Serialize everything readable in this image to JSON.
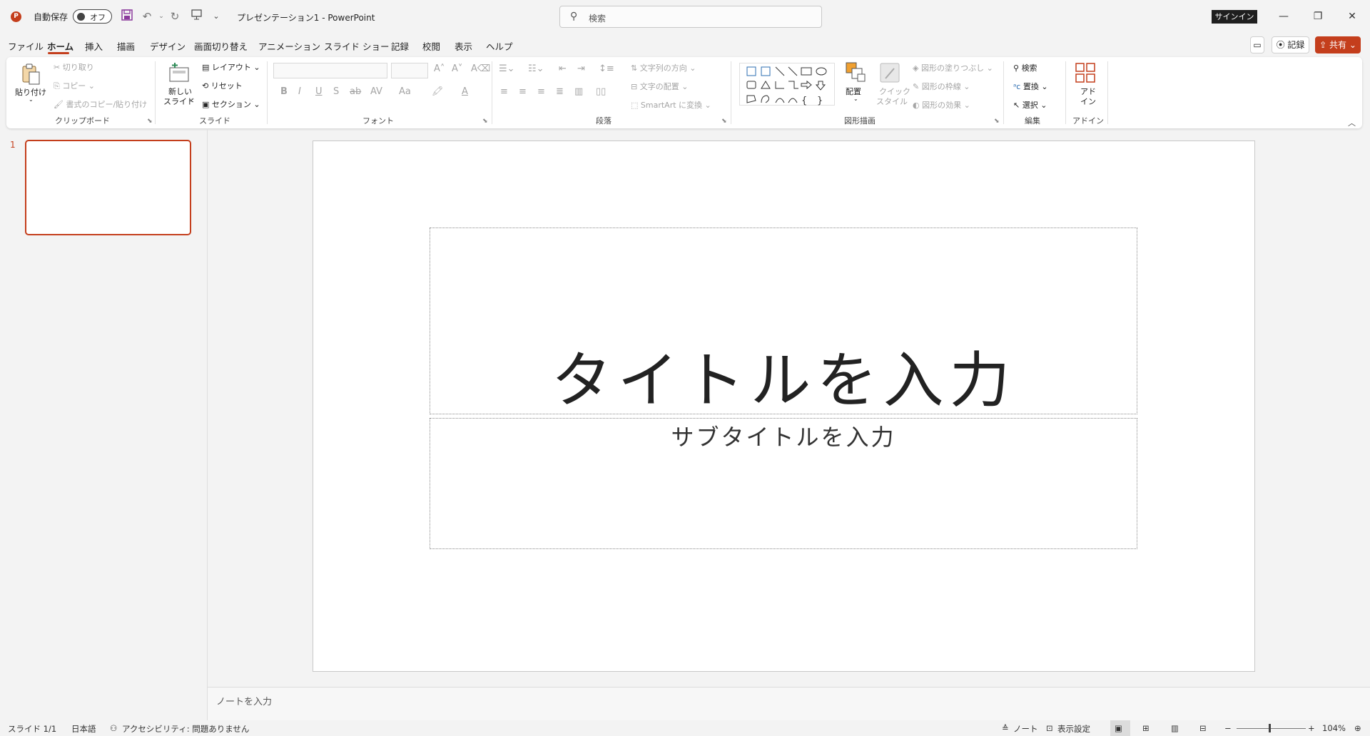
{
  "title_bar": {
    "app_icon": "P",
    "autosave_label": "自動保存",
    "autosave_state": "オフ",
    "doc_title": "プレゼンテーション1  -  PowerPoint",
    "search_placeholder": "検索",
    "signin": "サインイン",
    "minimize": "—",
    "restore": "❐",
    "close": "✕"
  },
  "menu": {
    "tabs": [
      "ファイル",
      "ホーム",
      "挿入",
      "描画",
      "デザイン",
      "画面切り替え",
      "アニメーション",
      "スライド ショー",
      "記録",
      "校閲",
      "表示",
      "ヘルプ"
    ],
    "active_tab": "ホーム",
    "record_button": "記録",
    "share_button": "共有"
  },
  "ribbon": {
    "clipboard": {
      "paste": "貼り付け",
      "cut": "切り取り",
      "copy": "コピー",
      "format_painter": "書式のコピー/貼り付け",
      "label": "クリップボード"
    },
    "slides": {
      "new_slide_1": "新しい",
      "new_slide_2": "スライド",
      "layout": "レイアウト",
      "reset": "リセット",
      "section": "セクション",
      "label": "スライド"
    },
    "font": {
      "label": "フォント",
      "bold": "B",
      "italic": "I",
      "underline": "U",
      "shadow": "S",
      "strike": "ab",
      "spacing": "AV",
      "case": "Aa"
    },
    "paragraph": {
      "text_direction": "文字列の方向",
      "align_text": "文字の配置",
      "smartart": "SmartArt に変換",
      "label": "段落"
    },
    "drawing": {
      "arrange": "配置",
      "quick_styles_1": "クイック",
      "quick_styles_2": "スタイル",
      "fill": "図形の塗りつぶし",
      "outline": "図形の枠線",
      "effects": "図形の効果",
      "label": "図形描画"
    },
    "editing": {
      "find": "検索",
      "replace": "置換",
      "select": "選択",
      "label": "編集"
    },
    "addins": {
      "label_1": "アド",
      "label_2": "イン",
      "label": "アドイン"
    }
  },
  "thumbnail_panel": {
    "slide_number": "1"
  },
  "slide": {
    "title": "タイトルを入力",
    "subtitle": "サブタイトルを入力"
  },
  "notes": {
    "placeholder": "ノートを入力"
  },
  "status_bar": {
    "slide_count": "スライド 1/1",
    "language": "日本語",
    "accessibility": "アクセシビリティ: 問題ありません",
    "notes": "ノート",
    "display_settings": "表示設定",
    "zoom_minus": "−",
    "zoom_plus": "+",
    "zoom": "104%"
  },
  "colors": {
    "accent": "#c43e1c",
    "ribbon_bg": "#ffffff",
    "app_bg": "#f3f3f3"
  }
}
